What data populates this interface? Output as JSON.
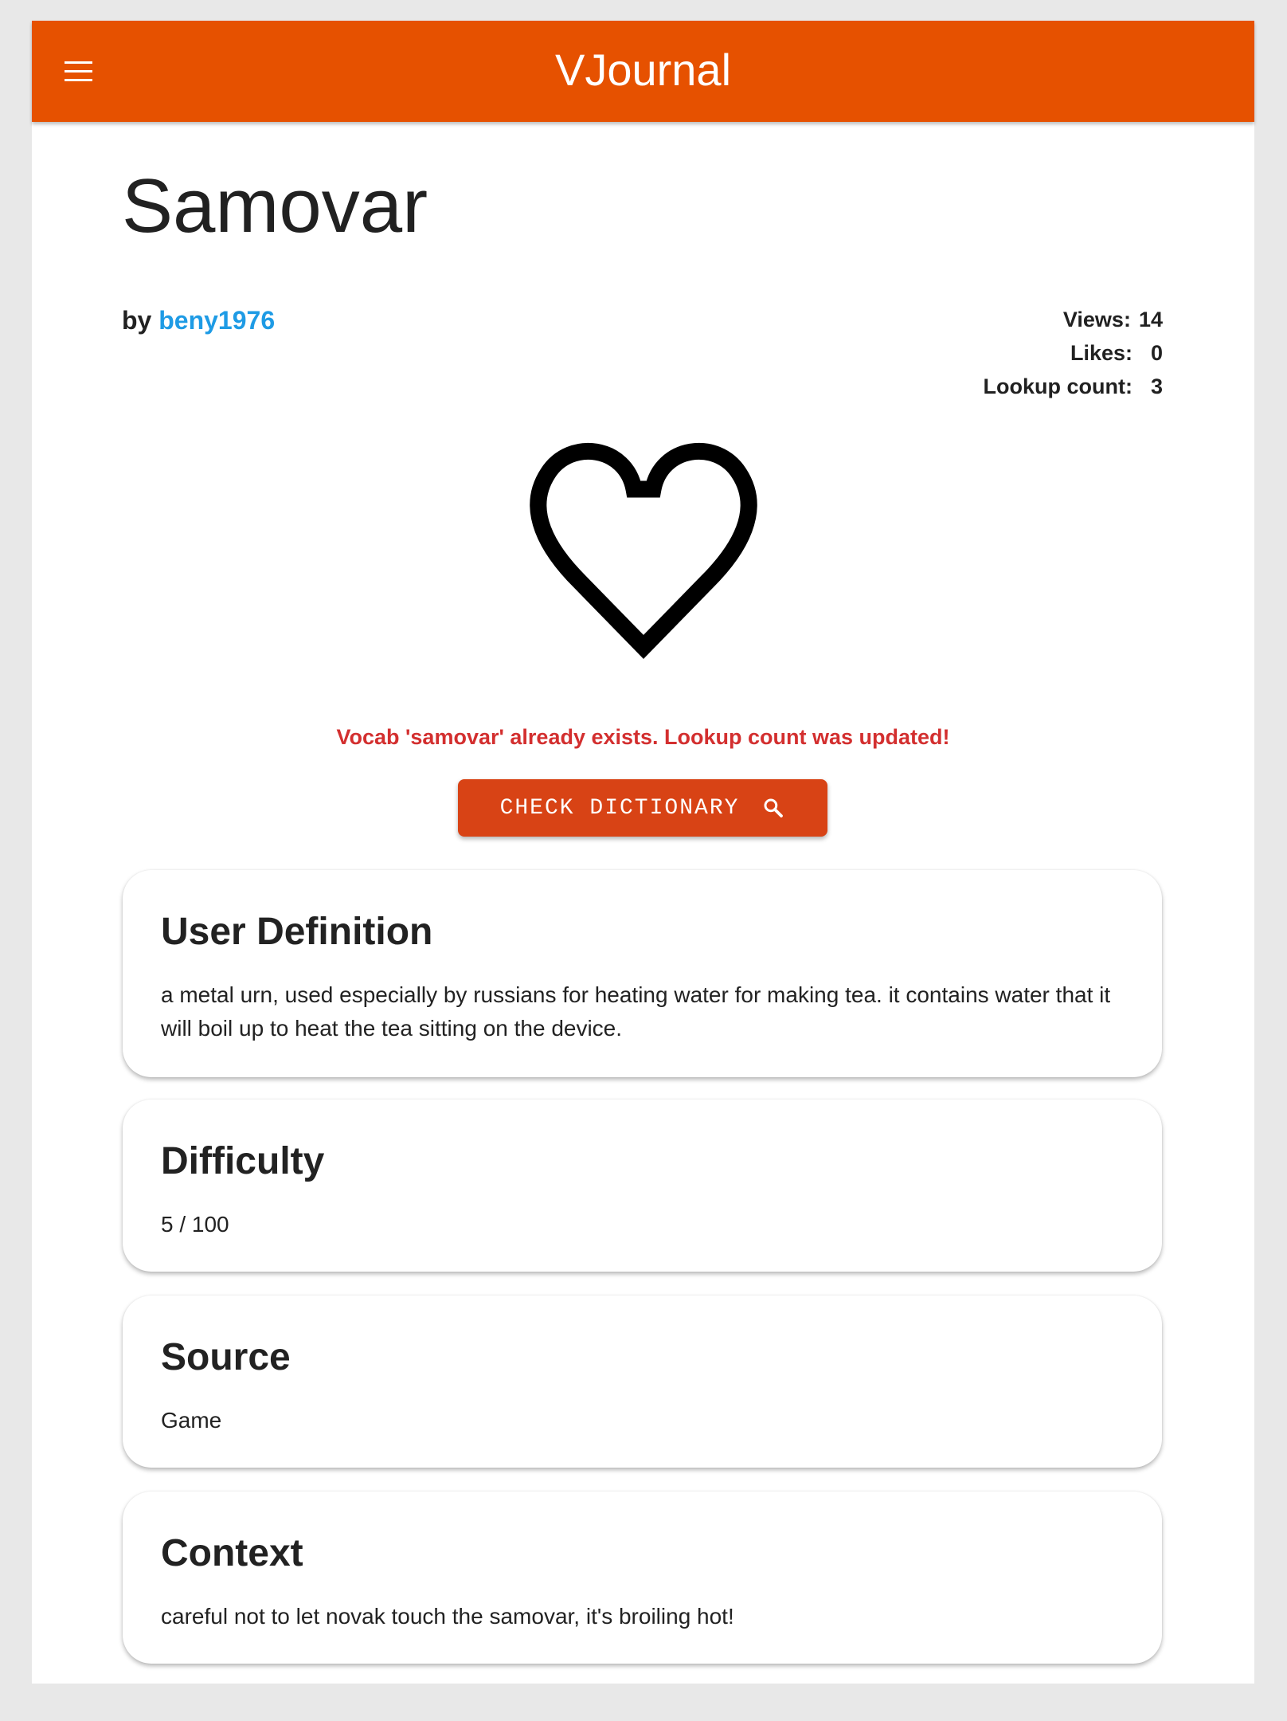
{
  "app": {
    "title": "VJournal"
  },
  "vocab": {
    "word": "Samovar",
    "by_prefix": "by",
    "author": "beny1976"
  },
  "stats": {
    "views_label": "Views:",
    "views": "14",
    "likes_label": "Likes:",
    "likes": "0",
    "lookup_label": "Lookup count:",
    "lookup": "3"
  },
  "like": {
    "icon": "heart-outline-icon",
    "liked": false
  },
  "status": {
    "message": "Vocab 'samovar' already exists. Lookup count was updated!",
    "color": "#d32f2f"
  },
  "actions": {
    "check_dictionary_label": "CHECK DICTIONARY",
    "check_dictionary_icon": "search-icon"
  },
  "cards": {
    "definition": {
      "title": "User Definition",
      "text": "a metal urn, used especially by russians for heating water for making tea. it contains water that it will boil up to heat the tea sitting on the device."
    },
    "difficulty": {
      "title": "Difficulty",
      "text": "5 / 100"
    },
    "source": {
      "title": "Source",
      "text": "Game"
    },
    "context": {
      "title": "Context",
      "text": "careful not to let novak touch the samovar, it's broiling hot!"
    }
  },
  "colors": {
    "appbar": "#e65100",
    "button": "#d84315",
    "link": "#1e9be5",
    "background": "#e8e8e8"
  }
}
